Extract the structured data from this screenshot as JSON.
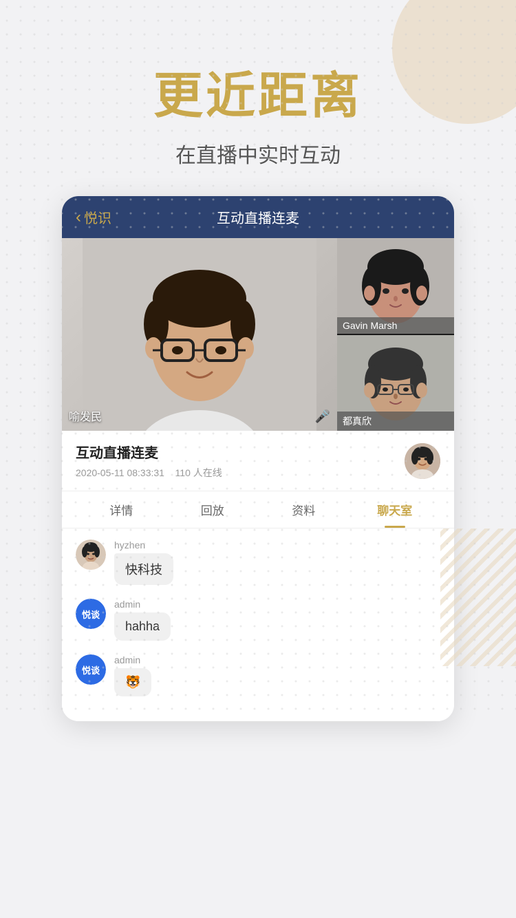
{
  "background": {
    "color": "#f2f2f4"
  },
  "header": {
    "main_title": "更近距离",
    "subtitle": "在直播中实时互动"
  },
  "phone": {
    "nav": {
      "back_label": "悦识",
      "title": "互动直播连麦"
    },
    "video": {
      "main_person": {
        "name": "喻发民"
      },
      "person2": {
        "name": "Gavin Marsh"
      },
      "person3": {
        "name": "都真欣"
      }
    },
    "info": {
      "title": "互动直播连麦",
      "date": "2020-05-11 08:33:31",
      "viewers": "110 人在线"
    },
    "tabs": [
      {
        "label": "详情",
        "active": false
      },
      {
        "label": "回放",
        "active": false
      },
      {
        "label": "资料",
        "active": false
      },
      {
        "label": "聊天室",
        "active": true
      }
    ],
    "chat": {
      "messages": [
        {
          "avatar_type": "person",
          "username": "hyzhen",
          "text": "快科技"
        },
        {
          "avatar_type": "logo",
          "logo_text": "悦谈",
          "username": "admin",
          "text": "hahha"
        },
        {
          "avatar_type": "logo",
          "logo_text": "悦谈",
          "username": "admin",
          "text": "🐯"
        }
      ]
    }
  }
}
